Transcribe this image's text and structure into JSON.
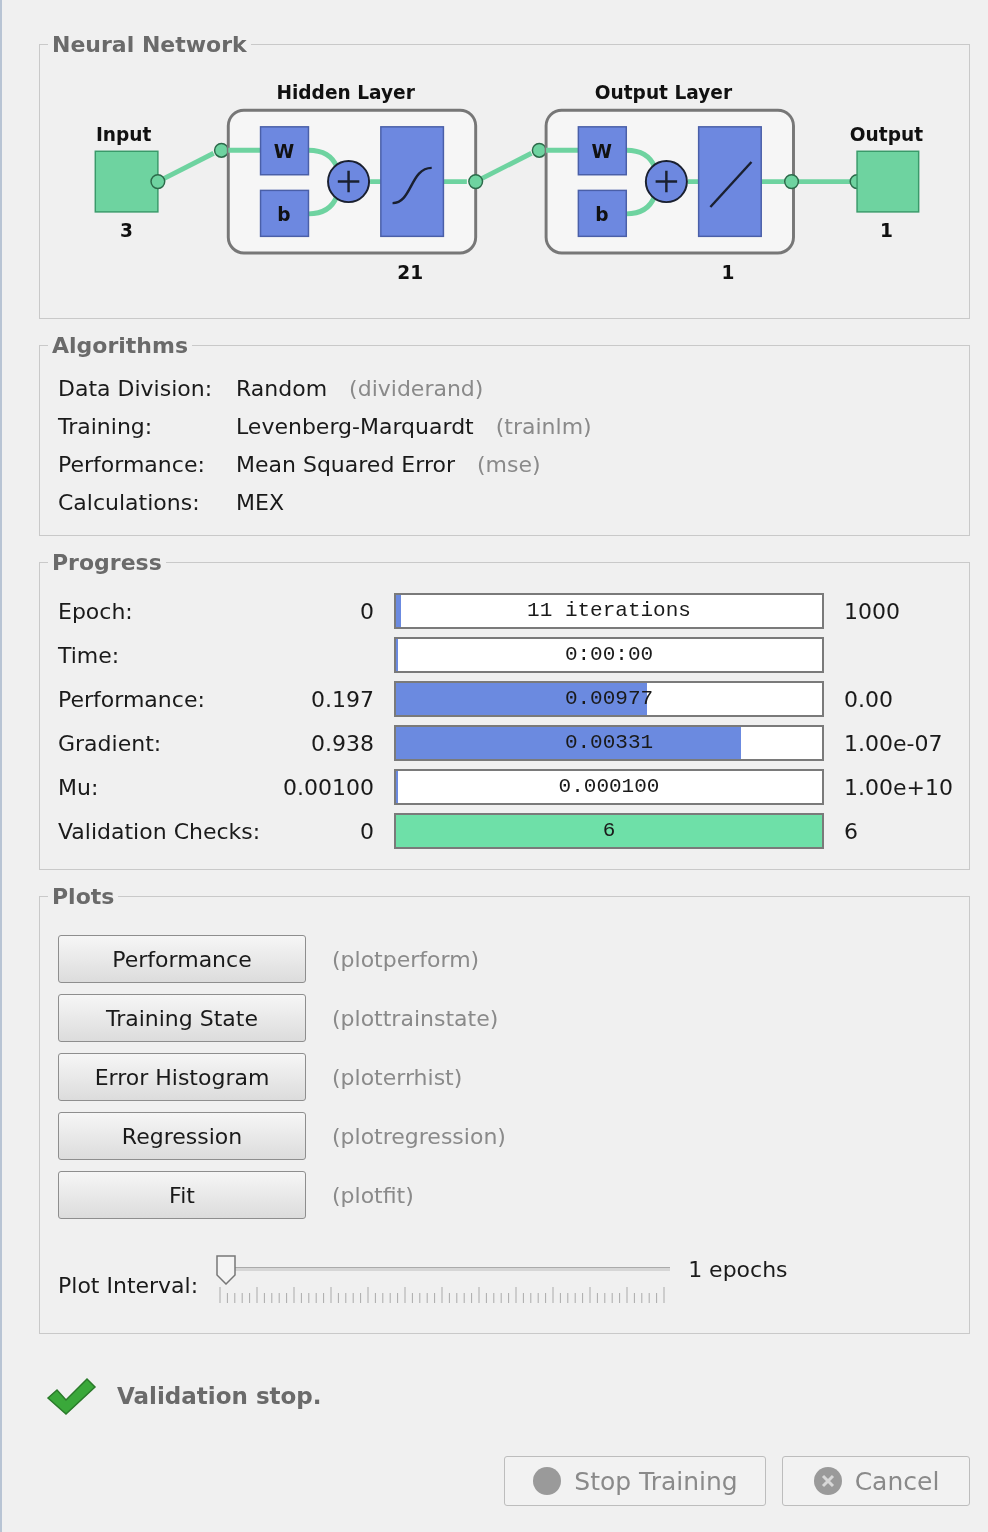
{
  "network": {
    "title": "Neural Network",
    "input": {
      "label": "Input",
      "size": "3"
    },
    "layers": [
      {
        "title": "Hidden Layer",
        "weight": "W",
        "bias": "b",
        "size": "21",
        "kind": "sigmoid"
      },
      {
        "title": "Output Layer",
        "weight": "W",
        "bias": "b",
        "size": "1",
        "kind": "linear"
      }
    ],
    "output": {
      "label": "Output",
      "size": "1"
    }
  },
  "algorithms": {
    "title": "Algorithms",
    "rows": [
      {
        "label": "Data Division:",
        "value": "Random",
        "function": "(dividerand)"
      },
      {
        "label": "Training:",
        "value": "Levenberg-Marquardt",
        "function": "(trainlm)"
      },
      {
        "label": "Performance:",
        "value": "Mean Squared Error",
        "function": "(mse)"
      },
      {
        "label": "Calculations:",
        "value": "MEX"
      }
    ]
  },
  "progress": {
    "title": "Progress",
    "rows": [
      {
        "label": "Epoch:",
        "start": "0",
        "reading": "11 iterations",
        "level": 0.011,
        "end": "1000",
        "color": "#6b8ae0"
      },
      {
        "label": "Time:",
        "reading": "0:00:00",
        "level": 0,
        "color": "#6b8ae0"
      },
      {
        "label": "Performance:",
        "start": "0.197",
        "reading": "0.00977",
        "level": 0.59,
        "end": "0.00",
        "color": "#6b8ae0"
      },
      {
        "label": "Gradient:",
        "start": "0.938",
        "reading": "0.00331",
        "level": 0.81,
        "end": "1.00e-07",
        "color": "#6b8ae0"
      },
      {
        "label": "Mu:",
        "start": "0.00100",
        "reading": "0.000100",
        "level": 0,
        "end": "1.00e+10",
        "color": "#6b8ae0"
      },
      {
        "label": "Validation Checks:",
        "start": "0",
        "reading": "6",
        "level": 1,
        "end": "6",
        "color": "#6ee0a8"
      }
    ]
  },
  "plots": {
    "title": "Plots",
    "buttons": [
      {
        "label": "Performance",
        "function": "(plotperform)"
      },
      {
        "label": "Training State",
        "function": "(plottrainstate)"
      },
      {
        "label": "Error Histogram",
        "function": "(ploterrhist)"
      },
      {
        "label": "Regression",
        "function": "(plotregression)"
      },
      {
        "label": "Fit",
        "function": "(plotfit)"
      }
    ],
    "interval": {
      "label": "Plot Interval:",
      "level": 0,
      "reading": "1 epochs"
    }
  },
  "status": {
    "message": "Validation stop."
  },
  "buttons": [
    {
      "label": "Stop Training",
      "kind": "stop",
      "disabled": true
    },
    {
      "label": "Cancel",
      "kind": "cancel",
      "disabled": true
    }
  ]
}
